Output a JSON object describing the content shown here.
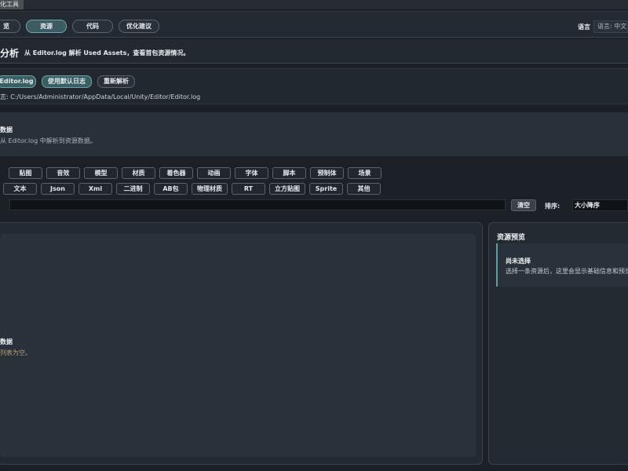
{
  "window": {
    "title_tab": "化工具"
  },
  "nav": {
    "tabs": [
      {
        "label": "览"
      },
      {
        "label": "资源"
      },
      {
        "label": "代码"
      },
      {
        "label": "优化建议"
      }
    ],
    "language_label": "语言",
    "language_value": "语言: 中文"
  },
  "header": {
    "title": "分析",
    "subtitle": "从 Editor.log 解析 Used Assets，查看首包资源情况。"
  },
  "log": {
    "open_button": "Editor.log",
    "default_button": "使用默认日志",
    "reparse_button": "重新解析",
    "path": "志: C:/Users/Administrator/AppData/Local/Unity/Editor/Editor.log"
  },
  "empty_state": {
    "heading": "数据",
    "text": "从 Editor.log 中解析到资源数据。"
  },
  "filters": {
    "row1": [
      "贴图",
      "音效",
      "模型",
      "材质",
      "着色器",
      "动画",
      "字体",
      "脚本",
      "预制体",
      "场景"
    ],
    "row2": [
      "文本",
      "Json",
      "Xml",
      "二进制",
      "AB包",
      "物理材质",
      "RT",
      "立方贴图",
      "Sprite",
      "其他"
    ]
  },
  "toolbar": {
    "search_value": "",
    "clear_button": "清空",
    "sort_label": "排序:",
    "sort_value": "大小降序"
  },
  "list": {
    "empty_heading": "数据",
    "empty_text": "列表为空。"
  },
  "preview": {
    "title": "资源预览",
    "heading": "尚未选择",
    "text": "选择一条资源后，这里会显示基础信息和预览。"
  }
}
